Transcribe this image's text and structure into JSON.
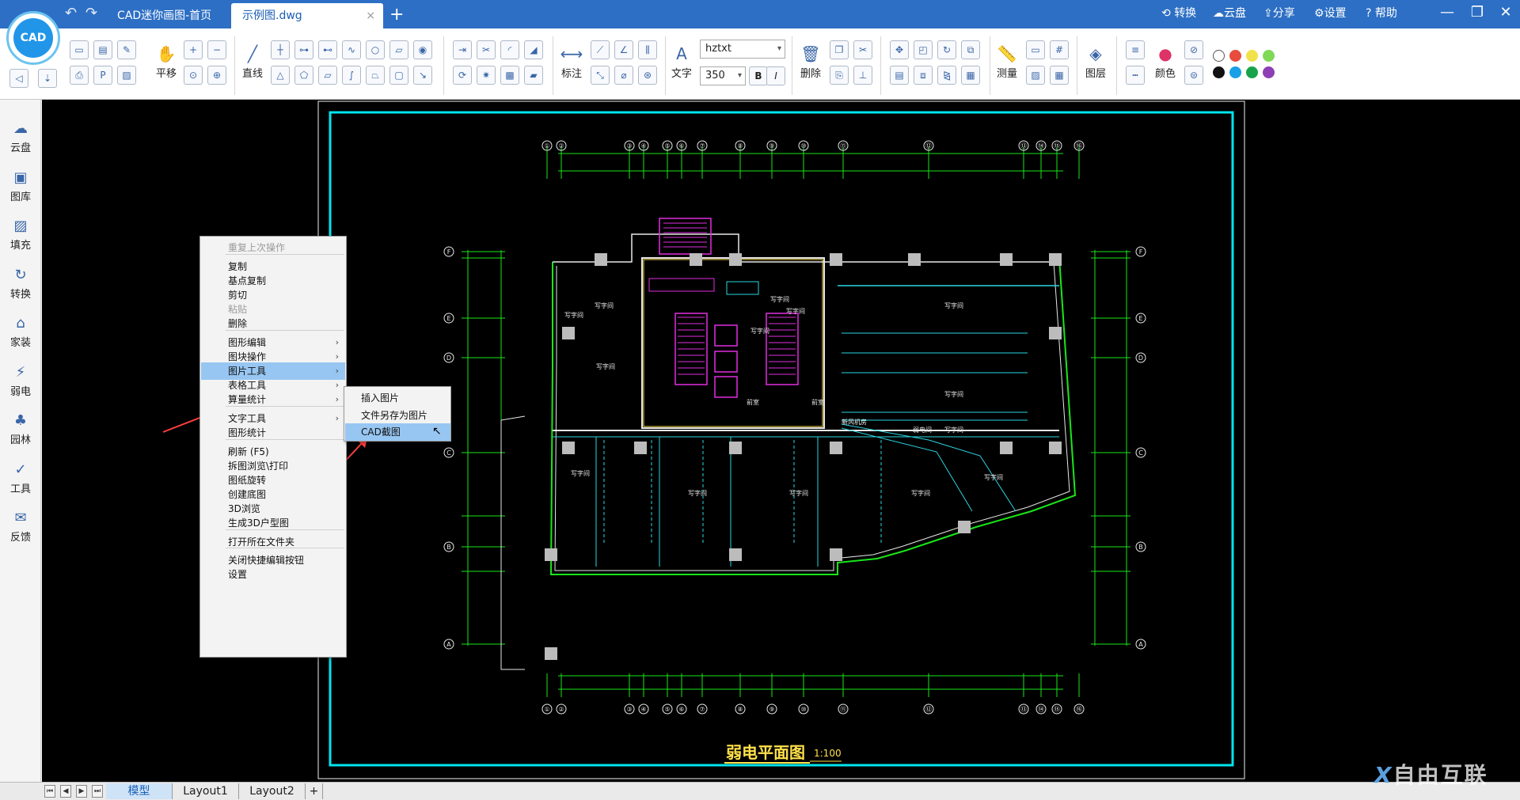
{
  "titlebar": {
    "tabs": [
      {
        "label": "CAD迷你画图-首页"
      },
      {
        "label": "示例图.dwg",
        "close": "×"
      }
    ],
    "add_tab": "+",
    "right": {
      "convert": "转换",
      "cloud": "云盘",
      "share": "分享",
      "settings": "设置",
      "help": "帮助"
    },
    "win": {
      "minimize": "—",
      "maximize": "❐",
      "close": "✕"
    },
    "undo_icon": "↶",
    "redo_icon": "↷"
  },
  "logo": {
    "text": "CAD"
  },
  "ribbon": {
    "pan": "平移",
    "line": "直线",
    "annotate": "标注",
    "text": "文字",
    "font_name": "hztxt",
    "font_size": "350",
    "bold": "B",
    "italic": "I",
    "delete": "删除",
    "measure": "测量",
    "layer": "图层",
    "color": "颜色"
  },
  "colors": {
    "swatches": [
      "#ffffff",
      "#e74c3c",
      "#f1e24b",
      "#7ed957",
      "#111111",
      "#1aa0e6",
      "#17a34a",
      "#8e3fb3"
    ]
  },
  "sidebar": [
    {
      "label": "云盘",
      "icon": "☁"
    },
    {
      "label": "图库",
      "icon": "▣"
    },
    {
      "label": "填充",
      "icon": "▨"
    },
    {
      "label": "转换",
      "icon": "↻"
    },
    {
      "label": "家装",
      "icon": "⌂"
    },
    {
      "label": "弱电",
      "icon": "⚡"
    },
    {
      "label": "园林",
      "icon": "♣"
    },
    {
      "label": "工具",
      "icon": "✓"
    },
    {
      "label": "反馈",
      "icon": "✉"
    }
  ],
  "drawing": {
    "title": "弱电平面图",
    "scale": "1:100",
    "room_labels": [
      "写字间",
      "写字间",
      "写字间",
      "写字间",
      "写字间",
      "写字间",
      "写字间",
      "写字间",
      "写字间",
      "写字间",
      "写字间",
      "写字间",
      "写字间",
      "写字间",
      "新风机房",
      "弱电间",
      "前室",
      "前室"
    ],
    "column_marks": [
      "①",
      "②",
      "③",
      "④",
      "⑤",
      "⑥",
      "⑦",
      "⑧",
      "⑨",
      "⑩",
      "⑪",
      "⑫",
      "⑬",
      "⑭",
      "⑮",
      "⑯"
    ],
    "row_marks": [
      "F",
      "E",
      "D",
      "C",
      "B",
      "A"
    ]
  },
  "context_menu": {
    "items": [
      {
        "label": "重复上次操作",
        "disabled": true
      },
      {
        "label": "复制"
      },
      {
        "label": "基点复制"
      },
      {
        "label": "剪切"
      },
      {
        "label": "粘贴",
        "disabled": true
      },
      {
        "label": "删除"
      },
      {
        "label": "图形编辑",
        "sub": true
      },
      {
        "label": "图块操作",
        "sub": true
      },
      {
        "label": "图片工具",
        "sub": true,
        "highlight": true
      },
      {
        "label": "表格工具",
        "sub": true
      },
      {
        "label": "算量统计",
        "sub": true
      },
      {
        "label": "文字工具",
        "sub": true
      },
      {
        "label": "图形统计"
      },
      {
        "label": "刷新 (F5)"
      },
      {
        "label": "拆图浏览\\打印"
      },
      {
        "label": "图纸旋转"
      },
      {
        "label": "创建底图"
      },
      {
        "label": "3D浏览"
      },
      {
        "label": "生成3D户型图"
      },
      {
        "label": "打开所在文件夹"
      },
      {
        "label": "关闭快捷编辑按钮"
      },
      {
        "label": "设置"
      }
    ],
    "submenu": [
      {
        "label": "插入图片"
      },
      {
        "label": "文件另存为图片"
      },
      {
        "label": "CAD截图",
        "highlight": true
      }
    ]
  },
  "bottom": {
    "tabs": [
      "模型",
      "Layout1",
      "Layout2"
    ],
    "add": "+"
  },
  "watermark": {
    "text": "自由互联"
  }
}
